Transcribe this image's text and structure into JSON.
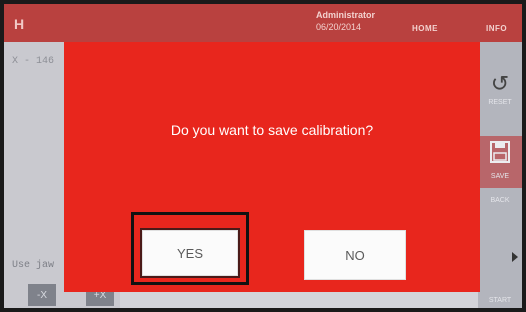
{
  "header": {
    "logo": "H",
    "user": "Administrator",
    "date": "06/20/2014",
    "home_label": "HOME",
    "info_label": "INFO"
  },
  "left_panel": {
    "coord_text": "X - 146",
    "use_text": "Use jaw",
    "minus_x": "-X",
    "plus_x": "+X"
  },
  "side_panel": {
    "reset_label": "RESET",
    "save_label": "SAVE",
    "back_label": "BACK",
    "start_label": "START",
    "reset_icon": "reset-icon",
    "save_icon": "floppy-disk-icon"
  },
  "dialog": {
    "message": "Do you want to save calibration?",
    "yes_label": "YES",
    "no_label": "NO",
    "background_color": "#e8261d"
  }
}
